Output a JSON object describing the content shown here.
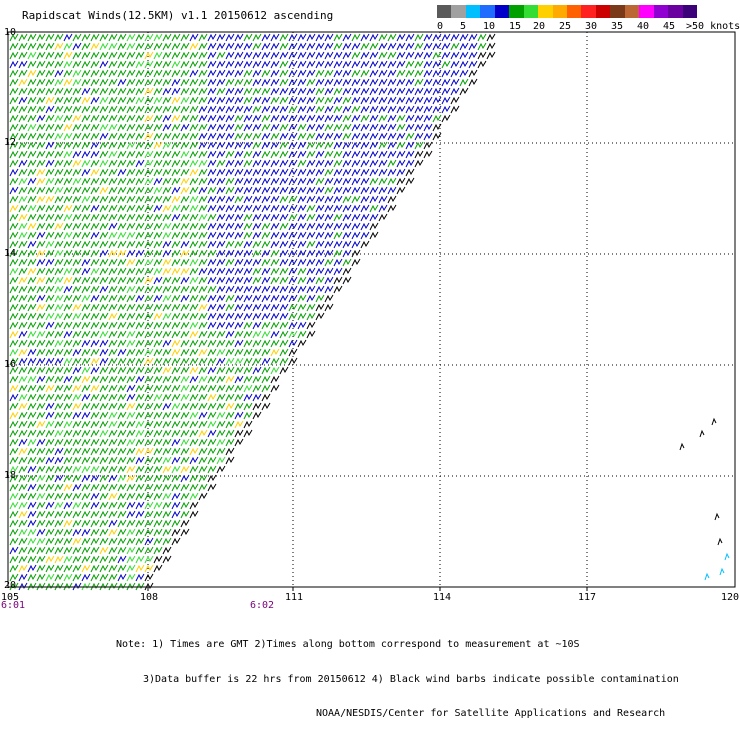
{
  "title": "Rapidscat Winds(12.5KM) v1.1 20150612 ascending",
  "legend": {
    "unit": ">50 knots",
    "colors": [
      "#5a5a5a",
      "#a0a0a0",
      "#00bfff",
      "#1e6dff",
      "#0000c8",
      "#00a000",
      "#33dd33",
      "#ffd000",
      "#ffaa00",
      "#ff6000",
      "#ff2020",
      "#cc0000",
      "#7a3a1a",
      "#bb6633",
      "#ff00ff",
      "#9000d0",
      "#6a00a0",
      "#3c0078"
    ],
    "labels": [
      "0",
      "5",
      "10",
      "15",
      "20",
      "25",
      "30",
      "35",
      "40",
      "45"
    ]
  },
  "axes": {
    "lat_labels": [
      "10",
      "12",
      "14",
      "16",
      "18",
      "20"
    ],
    "lon_labels": [
      "105",
      "108",
      "111",
      "114",
      "117",
      "120"
    ]
  },
  "times": [
    "6:01",
    "6:02"
  ],
  "notes": [
    "Note: 1) Times are GMT 2)Times along bottom correspond to measurement at ~10S",
    "3)Data buffer is 22 hrs from 20150612 4) Black wind barbs indicate possible contamination",
    "NOAA/NESDIS/Center for Satellite Applications and Research"
  ]
}
